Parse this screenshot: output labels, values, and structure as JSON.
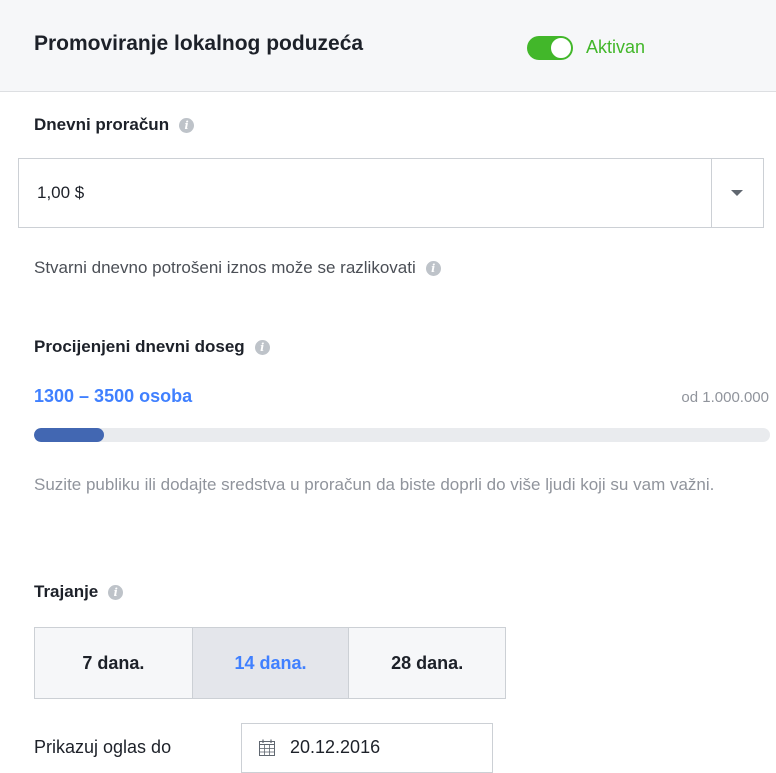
{
  "header": {
    "title": "Promoviranje lokalnog poduzeća",
    "toggle_on": true,
    "status": "Aktivan"
  },
  "budget": {
    "label": "Dnevni proračun",
    "value": "1,00 $",
    "note": "Stvarni dnevno potrošeni iznos može se razlikovati"
  },
  "reach": {
    "label": "Procijenjeni dnevni doseg",
    "range": "1300 – 3500 osoba",
    "total": "od 1.000.000",
    "fill_fraction": 0.095,
    "hint": "Suzite publiku ili dodajte sredstva u proračun da biste doprli do više ljudi koji su vam važni."
  },
  "duration": {
    "label": "Trajanje",
    "options": [
      "7 dana.",
      "14 dana.",
      "28 dana."
    ],
    "selected_index": 1
  },
  "end_date": {
    "label": "Prikazuj oglas do",
    "value": "20.12.2016"
  },
  "icons": {
    "info": "info-icon",
    "dropdown": "chevron-down-icon",
    "calendar": "calendar-icon"
  },
  "colors": {
    "accent_green": "#42b72a",
    "accent_blue": "#4080ff",
    "progress_fill": "#4267b2"
  }
}
